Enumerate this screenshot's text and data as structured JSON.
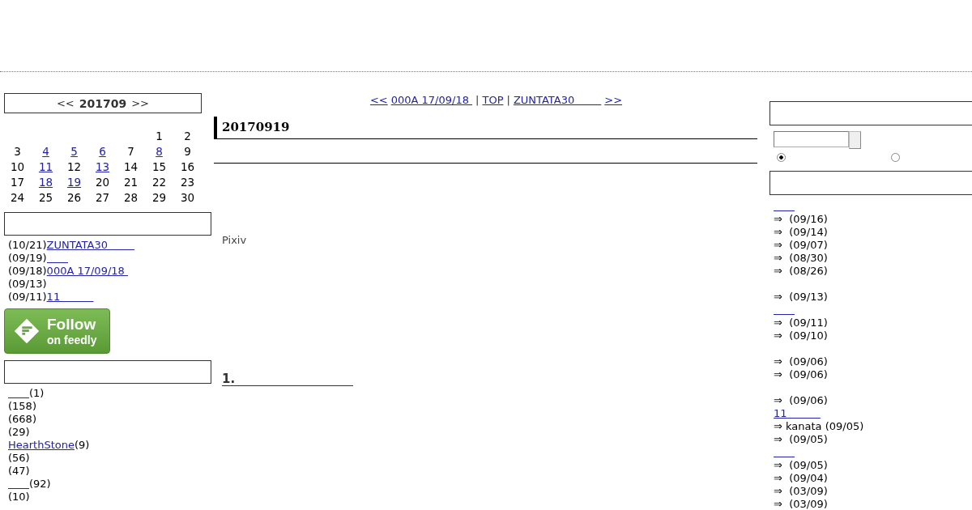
{
  "calendar": {
    "prev": "<<",
    "month": "201709",
    "next": ">>",
    "weeks": [
      [
        {
          "day": "1",
          "linked": false
        },
        {
          "day": "2",
          "linked": false
        }
      ],
      [
        {
          "day": "3",
          "linked": false
        },
        {
          "day": "4",
          "linked": true
        },
        {
          "day": "5",
          "linked": true
        },
        {
          "day": "6",
          "linked": true
        },
        {
          "day": "7",
          "linked": false
        },
        {
          "day": "8",
          "linked": true
        },
        {
          "day": "9",
          "linked": false
        }
      ],
      [
        {
          "day": "10",
          "linked": false
        },
        {
          "day": "11",
          "linked": true
        },
        {
          "day": "12",
          "linked": false
        },
        {
          "day": "13",
          "linked": true
        },
        {
          "day": "14",
          "linked": false
        },
        {
          "day": "15",
          "linked": false
        },
        {
          "day": "16",
          "linked": false
        }
      ],
      [
        {
          "day": "17",
          "linked": false
        },
        {
          "day": "18",
          "linked": true
        },
        {
          "day": "19",
          "linked": true
        },
        {
          "day": "20",
          "linked": false
        },
        {
          "day": "21",
          "linked": false
        },
        {
          "day": "22",
          "linked": false
        },
        {
          "day": "23",
          "linked": false
        }
      ],
      [
        {
          "day": "24",
          "linked": false
        },
        {
          "day": "25",
          "linked": false
        },
        {
          "day": "26",
          "linked": false
        },
        {
          "day": "27",
          "linked": false
        },
        {
          "day": "28",
          "linked": false
        },
        {
          "day": "29",
          "linked": false
        },
        {
          "day": "30",
          "linked": false
        }
      ]
    ]
  },
  "recent_entries": [
    {
      "date": "(10/21)",
      "title": "ZUNTATA30        "
    },
    {
      "date": "(09/19)",
      "blank_link": true
    },
    {
      "date": "(09/18)",
      "title": "000A 17/09/18 "
    },
    {
      "date": "(09/13)"
    },
    {
      "date": "(09/11)",
      "title": "11          "
    }
  ],
  "feedly_button": {
    "line_1": "Follow",
    "line_2": "on feedly"
  },
  "categories": [
    {
      "blank_link": true,
      "count": "(1)"
    },
    {
      "count": "(158)"
    },
    {
      "count": "(668)"
    },
    {
      "count": "(29)"
    },
    {
      "name": "HearthStone",
      "count": "(9)"
    },
    {
      "count": "(56)"
    },
    {
      "count": "(47)"
    },
    {
      "blank_link": true,
      "count": "(92)"
    },
    {
      "count": "(10)"
    }
  ],
  "entry_nav": {
    "prev": "<<",
    "prev_title": "000A 17/09/18 ",
    "separator_1": "|",
    "top": "TOP",
    "separator_2": "|",
    "next_title": "ZUNTATA30        ",
    "next": ">>"
  },
  "entry": {
    "date": "20170919",
    "body_text": "Pixiv",
    "section_heading": "1.                            "
  },
  "search": {
    "options": [
      {
        "selected": true
      },
      {
        "selected": false
      }
    ]
  },
  "comments": [
    {
      "kind": "blank_link"
    },
    {
      "kind": "entry",
      "text": "⇒  (09/16)"
    },
    {
      "kind": "entry",
      "text": "⇒  (09/14)"
    },
    {
      "kind": "entry",
      "text": "⇒  (09/07)"
    },
    {
      "kind": "entry",
      "text": "⇒  (08/30)"
    },
    {
      "kind": "entry",
      "text": "⇒  (08/26)"
    },
    {
      "kind": "spacer"
    },
    {
      "kind": "entry",
      "text": "⇒  (09/13)"
    },
    {
      "kind": "blank_link"
    },
    {
      "kind": "entry",
      "text": "⇒  (09/11)"
    },
    {
      "kind": "entry",
      "text": "⇒  (09/10)"
    },
    {
      "kind": "spacer"
    },
    {
      "kind": "entry",
      "text": "⇒  (09/06)"
    },
    {
      "kind": "entry",
      "text": "⇒  (09/06)"
    },
    {
      "kind": "spacer"
    },
    {
      "kind": "entry",
      "text": "⇒  (09/06)"
    },
    {
      "kind": "link",
      "text": "11          "
    },
    {
      "kind": "entry",
      "text": "⇒ kanata (09/05)"
    },
    {
      "kind": "entry",
      "text": "⇒  (09/05)"
    },
    {
      "kind": "blank_link"
    },
    {
      "kind": "entry",
      "text": "⇒  (09/05)"
    },
    {
      "kind": "entry",
      "text": "⇒  (09/04)"
    },
    {
      "kind": "entry",
      "text": "⇒  (03/09)"
    },
    {
      "kind": "entry",
      "text": "⇒  (03/09)"
    }
  ]
}
